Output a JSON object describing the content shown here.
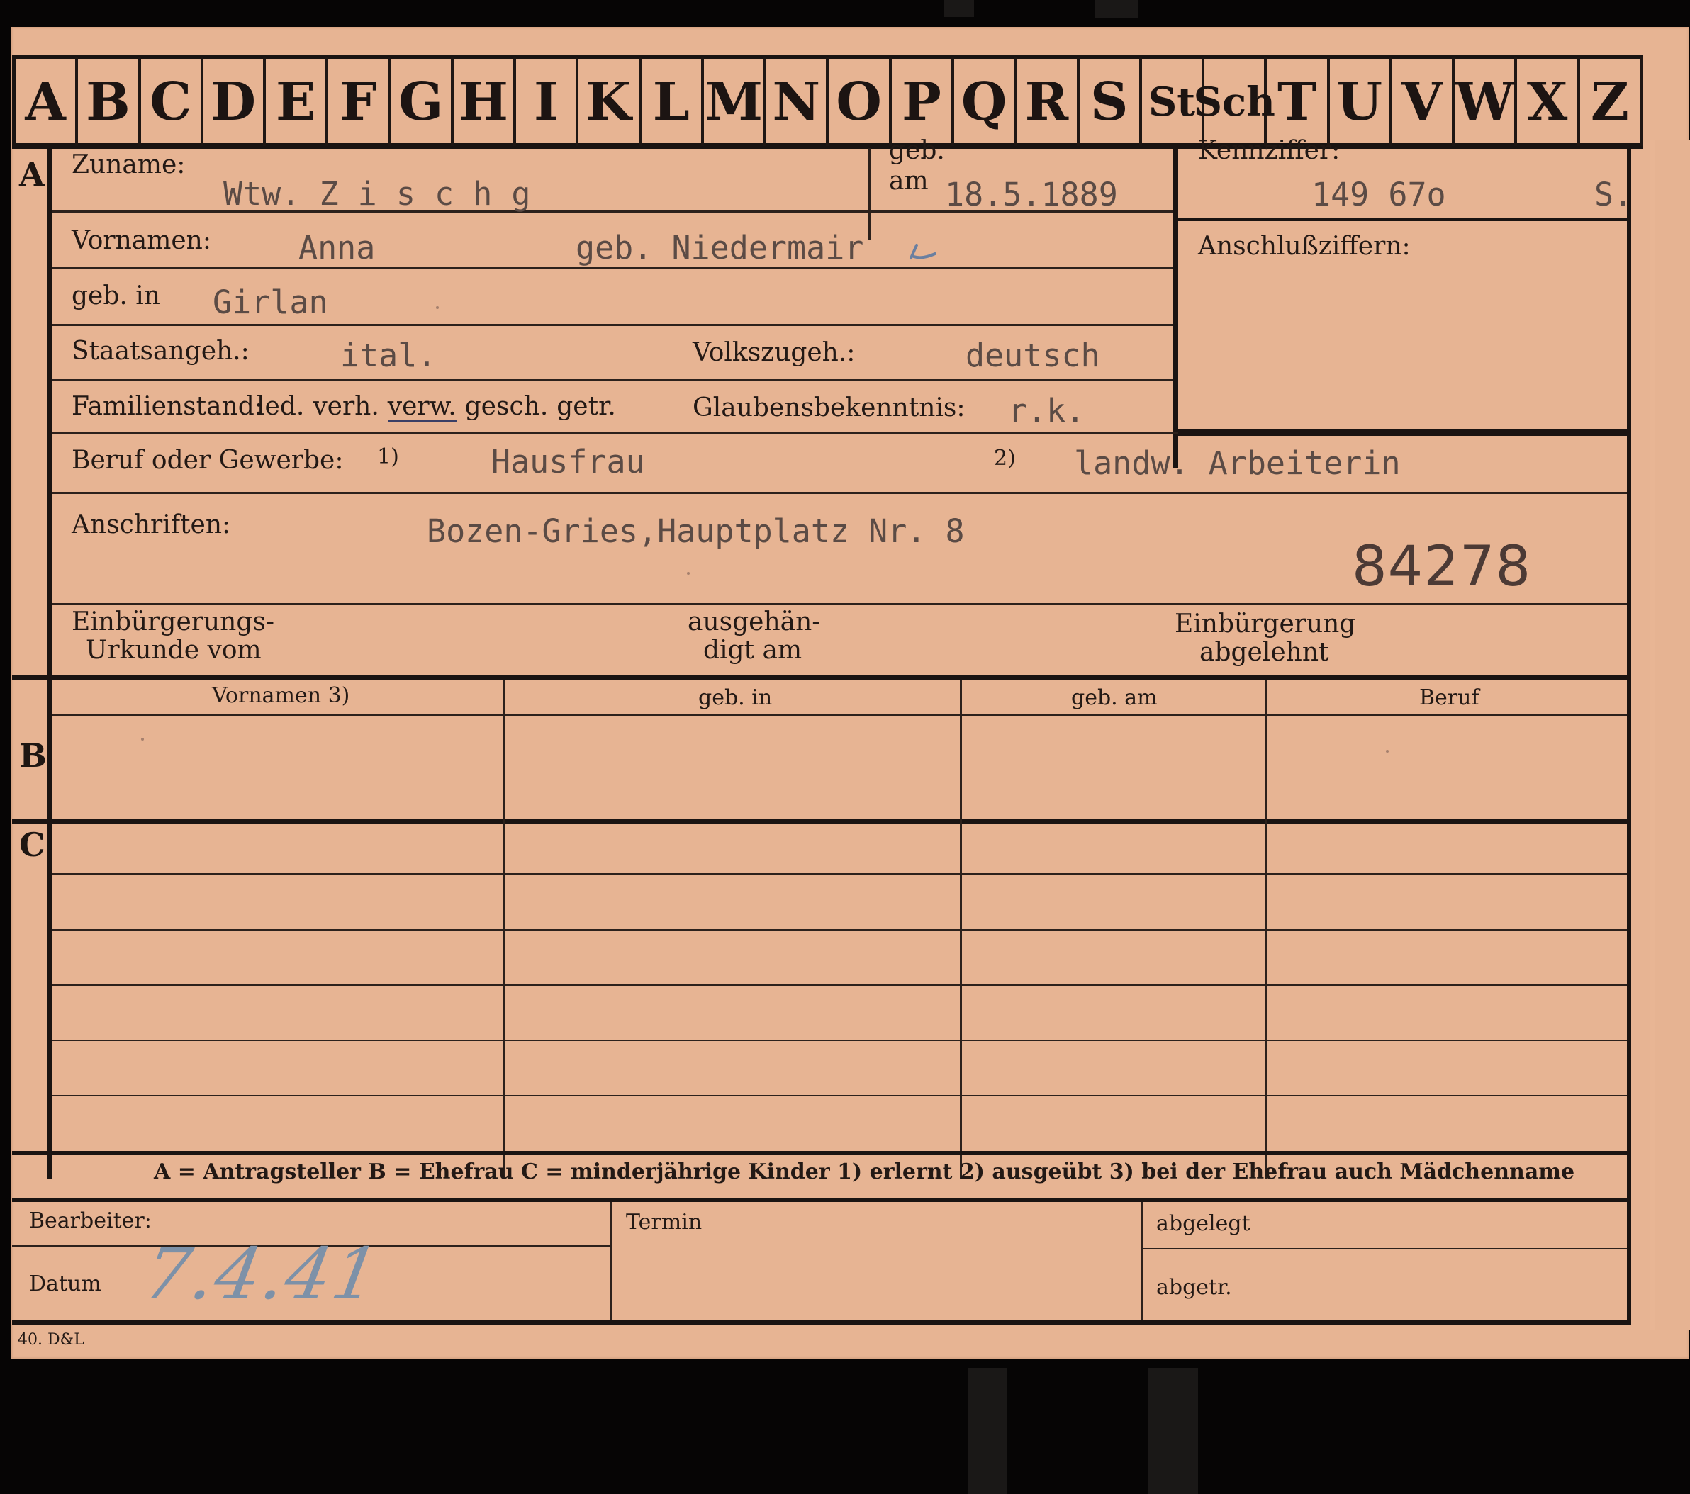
{
  "alphabet_tabs": [
    "A",
    "B",
    "C",
    "D",
    "E",
    "F",
    "G",
    "H",
    "I",
    "K",
    "L",
    "M",
    "N",
    "O",
    "P",
    "Q",
    "R",
    "S",
    "St",
    "Sch",
    "T",
    "U",
    "V",
    "W",
    "X",
    "Z"
  ],
  "section_a": {
    "letter": "A",
    "zuname_label": "Zuname:",
    "zuname_value": "Wtw. Z i s c h g",
    "geb_am_label_1": "geb.",
    "geb_am_label_2": "am",
    "geb_am_value": "18.5.1889",
    "kennziffer_label": "Kennziffer:",
    "kennziffer_value": "149 67o",
    "kennziffer_suffix": "S.",
    "anschluss_label": "Anschlußziffern:",
    "vornamen_label": "Vornamen:",
    "vornamen_value": "Anna",
    "geb_name_value": "geb. Niedermair",
    "geb_in_label": "geb. in",
    "geb_in_value": "Girlan",
    "staatsangeh_label": "Staatsangeh.:",
    "staatsangeh_value": "ital.",
    "volkszugeh_label": "Volkszugeh.:",
    "volkszugeh_value": "deutsch",
    "familienstand_label": "Familienstand:",
    "familienstand_options": [
      "led.",
      "verh.",
      "verw.",
      "gesch.",
      "getr."
    ],
    "familienstand_selected": "verw.",
    "glaubens_label": "Glaubensbekenntnis:",
    "glaubens_value": "r.k.",
    "beruf_label": "Beruf oder Gewerbe:",
    "beruf_note_1": "1)",
    "beruf_value_1": "Hausfrau",
    "beruf_note_2": "2)",
    "beruf_value_2": "landw. Arbeiterin",
    "anschriften_label": "Anschriften:",
    "anschriften_value": "Bozen-Gries,Hauptplatz Nr. 8",
    "number_stamp": "84278",
    "einbuergerung_urkunde_l1": "Einbürgerungs-",
    "einbuergerung_urkunde_l2": "Urkunde vom",
    "ausgehaendigt_l1": "ausgehän-",
    "ausgehaendigt_l2": "digt am",
    "abgelehnt_l1": "Einbürgerung",
    "abgelehnt_l2": "abgelehnt"
  },
  "section_b": {
    "letter": "B",
    "columns": [
      "Vornamen 3)",
      "geb. in",
      "geb. am",
      "Beruf"
    ]
  },
  "section_c": {
    "letter": "C"
  },
  "legend": "A = Antragsteller  B = Ehefrau  C = minderjährige Kinder  1) erlernt  2) ausgeübt  3) bei der Ehefrau auch Mädchenname",
  "footer": {
    "bearbeiter_label": "Bearbeiter:",
    "datum_label": "Datum",
    "datum_value": "7.4.41",
    "termin_label": "Termin",
    "abgelegt_label": "abgelegt",
    "abgetr_label": "abgetr.",
    "form_code": "40. D&L"
  }
}
